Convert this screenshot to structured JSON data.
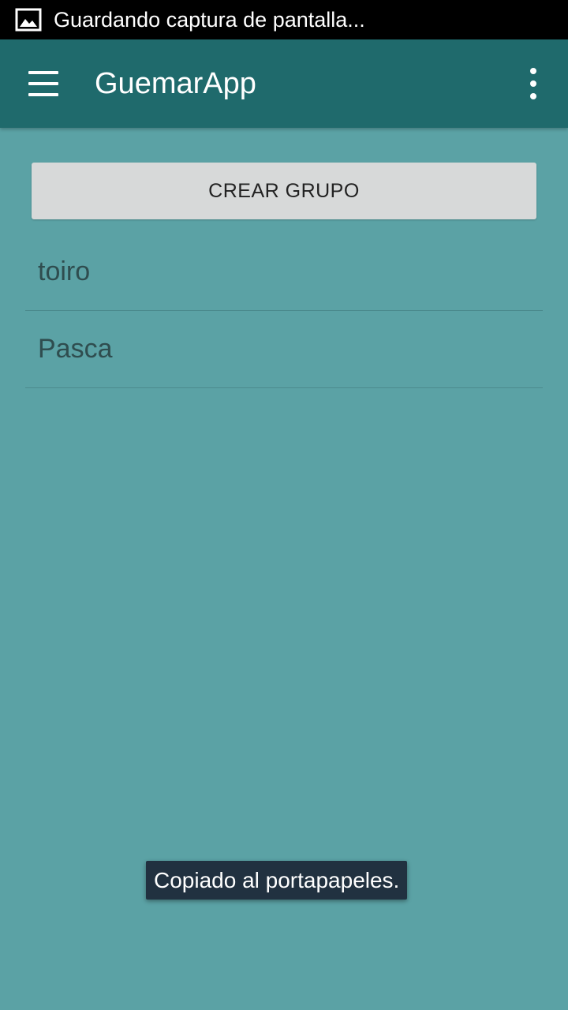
{
  "status_bar": {
    "icon": "image-icon",
    "text": "Guardando captura de pantalla..."
  },
  "app_bar": {
    "menu_icon": "hamburger-menu-icon",
    "title": "GuemarApp",
    "overflow_icon": "more-vert-icon"
  },
  "main": {
    "create_group_label": "CREAR GRUPO",
    "groups": [
      {
        "label": "toiro"
      },
      {
        "label": "Pasca"
      }
    ]
  },
  "toast": {
    "text": "Copiado al portapapeles."
  },
  "colors": {
    "background": "#5ba2a5",
    "app_bar": "#1f6a6c",
    "status_bar": "#000000",
    "button": "#d7d9d9",
    "toast": "#213140"
  }
}
